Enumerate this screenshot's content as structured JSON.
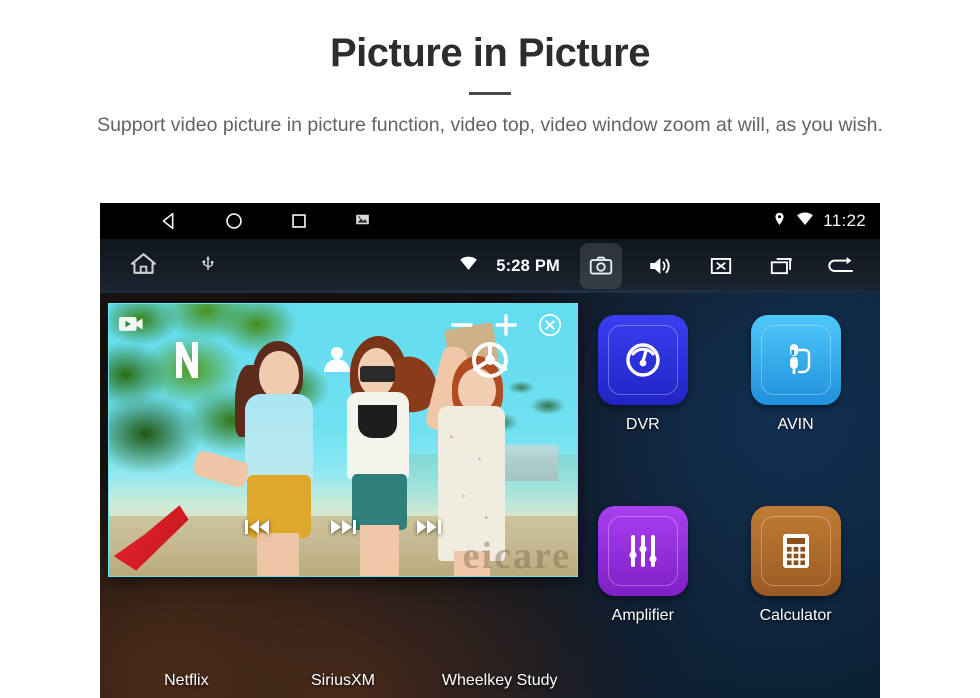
{
  "header": {
    "title": "Picture in Picture",
    "subtitle": "Support video picture in picture function, video top, video window zoom at will, as you wish."
  },
  "device": {
    "status_bar": {
      "nav_buttons": [
        {
          "name": "back",
          "icon": "triangle-left-icon"
        },
        {
          "name": "home",
          "icon": "circle-icon"
        },
        {
          "name": "recents",
          "icon": "square-icon"
        },
        {
          "name": "screenshot",
          "icon": "image-icon"
        }
      ],
      "location_icon": "location-pin-icon",
      "wifi_icon": "wifi-icon",
      "time": "11:22"
    },
    "toolbar": {
      "home_icon": "home-icon",
      "usb_icon": "usb-icon",
      "wifi_icon": "wifi-icon",
      "time": "5:28 PM",
      "buttons": [
        {
          "name": "camera",
          "icon": "camera-icon",
          "active": true
        },
        {
          "name": "volume",
          "icon": "speaker-icon",
          "active": false
        },
        {
          "name": "mute",
          "icon": "close-box-icon",
          "active": false
        },
        {
          "name": "recents",
          "icon": "windows-icon",
          "active": false
        },
        {
          "name": "back",
          "icon": "back-arrow-icon",
          "active": false
        }
      ]
    },
    "apps": [
      {
        "label": "Netflix",
        "color": "#18a319",
        "color2": "#0e8a10",
        "glyph": "netflix-icon"
      },
      {
        "label": "SiriusXM",
        "color": "#d9245c",
        "color2": "#b81548",
        "glyph": "siriusxm-icon"
      },
      {
        "label": "Wheelkey Study",
        "color": "#8a1fd4",
        "color2": "#7214b8",
        "glyph": "steering-wheel-icon"
      },
      {
        "label": "DVR",
        "color": "#3034e8",
        "color2": "#2124c4",
        "glyph": "gauge-icon"
      },
      {
        "label": "AVIN",
        "color": "#3fb8f5",
        "color2": "#2090dc",
        "glyph": "av-plug-icon"
      },
      {
        "label": "Amplifier",
        "color": "#9b35e0",
        "color2": "#7f1fc6",
        "glyph": "equalizer-icon"
      },
      {
        "label": "Calculator",
        "color": "#b5702f",
        "color2": "#9a5a22",
        "glyph": "calculator-icon"
      }
    ],
    "pip": {
      "camera_icon": "video-camera-icon",
      "zoom_out_icon": "minus-icon",
      "zoom_in_icon": "plus-icon",
      "close_icon": "close-circle-icon",
      "prev_icon": "previous-track-icon",
      "play_icon": "play-pause-icon",
      "next_icon": "next-track-icon",
      "watermark": "eicare"
    }
  },
  "colors": {
    "title": "#2d2d2d",
    "subtitle": "#636363",
    "toolbar_bg": "#161d27",
    "pip_tint": "#55e0ef"
  }
}
